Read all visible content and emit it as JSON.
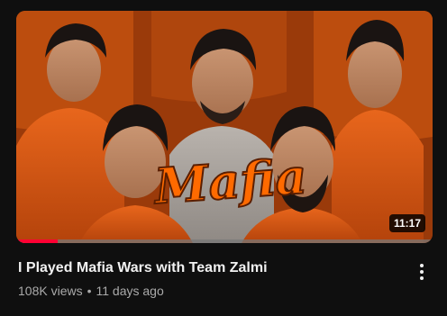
{
  "video": {
    "title": "I Played Mafia Wars with Team Zalmi",
    "views": "108K views",
    "separator": "•",
    "age": "11 days ago",
    "duration": "11:17",
    "watched_fraction": 0.1,
    "thumbnail_text": "Mafia",
    "thumbnail_text_color": "#ff6a00"
  },
  "menu": {
    "icon": "more-vert-icon"
  },
  "colors": {
    "background": "#0f0f0f",
    "progress": "#ff0033",
    "title": "#f1f1f1",
    "meta": "#aaaaaa"
  }
}
